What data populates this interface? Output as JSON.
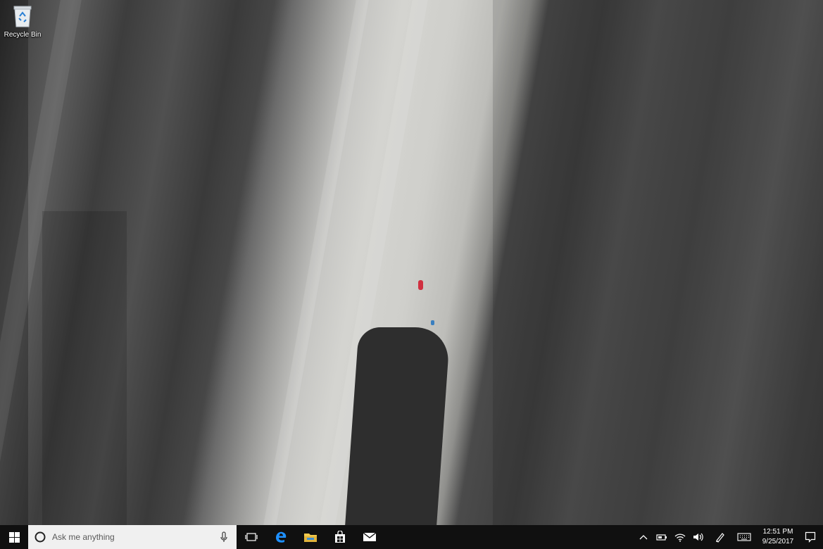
{
  "desktop": {
    "icons": [
      {
        "label": "Recycle Bin",
        "icon": "recycle-bin-icon"
      }
    ]
  },
  "taskbar": {
    "start_icon": "windows-logo-icon",
    "search": {
      "placeholder": "Ask me anything",
      "cortana_icon": "cortana-circle-icon",
      "mic_icon": "microphone-icon"
    },
    "pinned": [
      {
        "name": "Task View",
        "icon": "task-view-icon"
      },
      {
        "name": "Microsoft Edge",
        "icon": "edge-icon"
      },
      {
        "name": "File Explorer",
        "icon": "file-explorer-icon"
      },
      {
        "name": "Store",
        "icon": "store-icon"
      },
      {
        "name": "Mail",
        "icon": "mail-icon"
      }
    ],
    "tray": {
      "icons": [
        "chevron-up-icon",
        "battery-icon",
        "wifi-icon",
        "volume-icon",
        "pen-icon",
        "keyboard-icon"
      ],
      "time": "12:51 PM",
      "date": "9/25/2017",
      "notification_icon": "action-center-icon"
    }
  },
  "colors": {
    "taskbar_bg": "#101010",
    "search_bg": "#f0f0f0",
    "edge_blue": "#1e90ff",
    "explorer_yellow": "#f2c94c"
  }
}
